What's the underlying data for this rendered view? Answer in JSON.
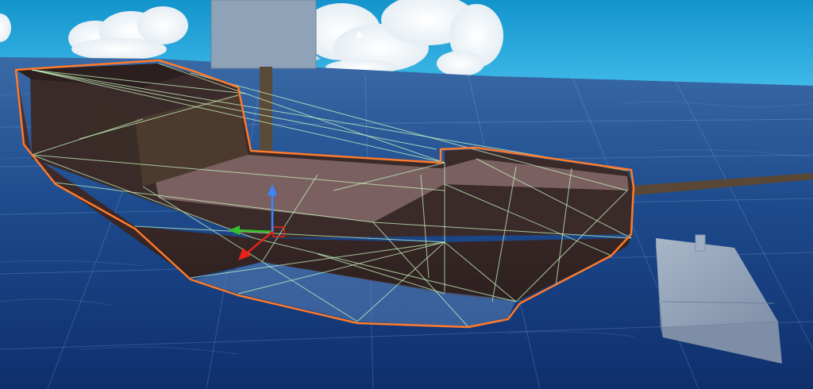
{
  "scene": {
    "view": "scene-view",
    "selected_object": "ship",
    "colors": {
      "sky": "#1aa0d6",
      "sky_horizon": "#3bb8e6",
      "ocean_far": "#2f5f9c",
      "ocean_near": "#123a7a",
      "hull_dark": "#3c2a2a",
      "hull_mid": "#5a4040",
      "deck": "#7a6060",
      "selection_outline": "#ff7a2a",
      "collider_wire": "#c8f7c0",
      "sail": "#8fa3b8",
      "crate": "#9aa8bc",
      "gizmo_x": "#e8221a",
      "gizmo_y": "#3a86ff",
      "gizmo_z": "#34c02a"
    },
    "icons": [
      "move-gizmo-icon",
      "light-gizmo-icon"
    ]
  }
}
